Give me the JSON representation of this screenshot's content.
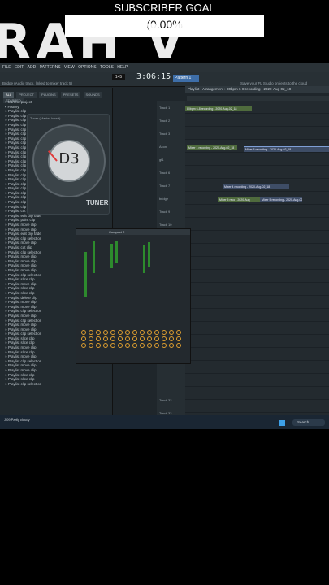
{
  "overlay": {
    "subscriber_goal": "SUBSCRIBER GOAL",
    "goal_percent": "(0.00%",
    "big_text": "RAH V"
  },
  "daw": {
    "menu": [
      "FILE",
      "EDIT",
      "ADD",
      "PATTERNS",
      "VIEW",
      "OPTIONS",
      "TOOLS",
      "HELP"
    ],
    "time": "3:06:15",
    "bpm": "145",
    "pattern": "Pattern 1",
    "song_title": "Bridge (Audio track, linked to mixer track 5)",
    "status_text": "Save your FL Studio projects to the cloud",
    "browser_tabs": [
      "ALL",
      "PROJECT",
      "PLUGINS",
      "PRESETS",
      "SOUNDS",
      "STARRED"
    ],
    "browser_items": [
      "Current project",
      "History",
      "Playlist clip",
      "Playlist clip",
      "Playlist clip",
      "Playlist clip",
      "Playlist clip",
      "Playlist clip",
      "Playlist clip",
      "Playlist clip",
      "Playlist clip",
      "Playlist clip",
      "Playlist clip",
      "Playlist clip",
      "Playlist clip",
      "Playlist clip",
      "Playlist clip",
      "Playlist clip",
      "Playlist clip",
      "Playlist clip",
      "Playlist clip",
      "Playlist clip",
      "Playlist clip",
      "Playlist clip selection",
      "Playlist cut clip",
      "Playlist edit clip fade",
      "Playlist paint clip",
      "Playlist move clip",
      "Playlist move clip",
      "Playlist edit clip fade",
      "Playlist clip selection",
      "Playlist move clip",
      "Playlist cut clip",
      "Playlist clip selection",
      "Playlist move clip",
      "Playlist move clip",
      "Playlist move clip",
      "Playlist move clip",
      "Playlist clip selection",
      "Playlist slice clip",
      "Playlist move clip",
      "Playlist slice clip",
      "Playlist slice clip",
      "Playlist delete clip",
      "Playlist move clip",
      "Playlist move clip",
      "Playlist clip selection",
      "Playlist move clip",
      "Playlist clip selection",
      "Playlist move clip",
      "Playlist move clip",
      "Playlist clip selection",
      "Playlist slice clip",
      "Playlist slice clip",
      "Playlist move clip",
      "Playlist slice clip",
      "Playlist move clip",
      "Playlist clip selection",
      "Playlist move clip",
      "Playlist move clip",
      "Playlist slice clip",
      "Playlist slice clip",
      "Playlist clip selection"
    ],
    "tuner_note": "D3",
    "tuner_logo": "TUNER",
    "tuner_header": "Tuner (Master Insert)",
    "playlist_header": "Playlist - Arrangement › 80bpm 6-8 recording - 2020-Aug-02_18",
    "tracks": [
      "Track 1",
      "Track 2",
      "Track 3",
      "Acon",
      "gt1",
      "Track 6",
      "Track 7",
      "bridge",
      "Track 9",
      "Track 10",
      "Track 32",
      "Track 33",
      "Track 34",
      "Track 35"
    ],
    "clips": [
      {
        "label": "80bpm 6-8 recording - 2020-Aug-02_18",
        "color": "green"
      },
      {
        "label": "Mixer 5 recording - 2020-Aug-02_18",
        "color": "blue"
      },
      {
        "label": "Mixer 1 recording - 2020-Aug-02_18",
        "color": "green"
      },
      {
        "label": "Mixer 4 recording - 2020-Aug-02_18",
        "color": "blue"
      },
      {
        "label": "Mixer 5 recording - 2020-Aug-02_18",
        "color": "blue"
      },
      {
        "label": "Mixer 5 reco - 2020-Aug",
        "color": "green"
      }
    ],
    "mixer_title": "Compact 2",
    "taskbar_user": "J:09\nPartly cloudy",
    "taskbar_search": "Search"
  }
}
